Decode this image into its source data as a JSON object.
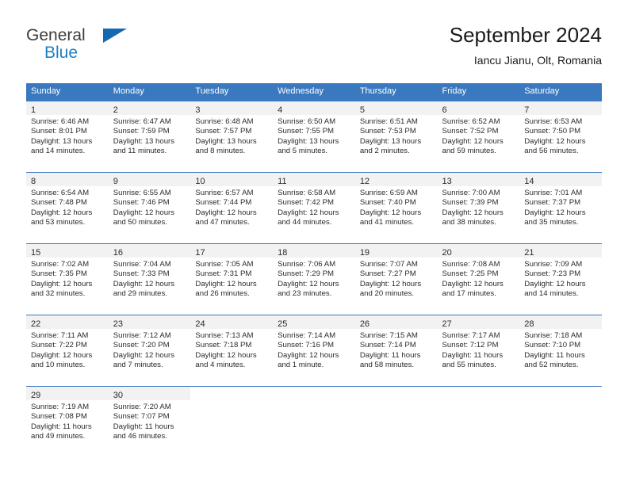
{
  "logo": {
    "primary_text": "General",
    "secondary_text": "Blue",
    "triangle_color": "#1569b0",
    "blue_color": "#1f7fc4"
  },
  "header": {
    "title": "September 2024",
    "subtitle": "Iancu Jianu, Olt, Romania"
  },
  "theme": {
    "header_background": "#3a79bf",
    "header_text": "#ffffff",
    "daynumber_band": "#f2f2f2",
    "grid_line": "#3a79bf",
    "body_text": "#2b2b2b"
  },
  "calendar": {
    "weekday_headers": [
      "Sunday",
      "Monday",
      "Tuesday",
      "Wednesday",
      "Thursday",
      "Friday",
      "Saturday"
    ],
    "weeks": [
      [
        {
          "day": "1",
          "sunrise": "Sunrise: 6:46 AM",
          "sunset": "Sunset: 8:01 PM",
          "daylight": "Daylight: 13 hours and 14 minutes."
        },
        {
          "day": "2",
          "sunrise": "Sunrise: 6:47 AM",
          "sunset": "Sunset: 7:59 PM",
          "daylight": "Daylight: 13 hours and 11 minutes."
        },
        {
          "day": "3",
          "sunrise": "Sunrise: 6:48 AM",
          "sunset": "Sunset: 7:57 PM",
          "daylight": "Daylight: 13 hours and 8 minutes."
        },
        {
          "day": "4",
          "sunrise": "Sunrise: 6:50 AM",
          "sunset": "Sunset: 7:55 PM",
          "daylight": "Daylight: 13 hours and 5 minutes."
        },
        {
          "day": "5",
          "sunrise": "Sunrise: 6:51 AM",
          "sunset": "Sunset: 7:53 PM",
          "daylight": "Daylight: 13 hours and 2 minutes."
        },
        {
          "day": "6",
          "sunrise": "Sunrise: 6:52 AM",
          "sunset": "Sunset: 7:52 PM",
          "daylight": "Daylight: 12 hours and 59 minutes."
        },
        {
          "day": "7",
          "sunrise": "Sunrise: 6:53 AM",
          "sunset": "Sunset: 7:50 PM",
          "daylight": "Daylight: 12 hours and 56 minutes."
        }
      ],
      [
        {
          "day": "8",
          "sunrise": "Sunrise: 6:54 AM",
          "sunset": "Sunset: 7:48 PM",
          "daylight": "Daylight: 12 hours and 53 minutes."
        },
        {
          "day": "9",
          "sunrise": "Sunrise: 6:55 AM",
          "sunset": "Sunset: 7:46 PM",
          "daylight": "Daylight: 12 hours and 50 minutes."
        },
        {
          "day": "10",
          "sunrise": "Sunrise: 6:57 AM",
          "sunset": "Sunset: 7:44 PM",
          "daylight": "Daylight: 12 hours and 47 minutes."
        },
        {
          "day": "11",
          "sunrise": "Sunrise: 6:58 AM",
          "sunset": "Sunset: 7:42 PM",
          "daylight": "Daylight: 12 hours and 44 minutes."
        },
        {
          "day": "12",
          "sunrise": "Sunrise: 6:59 AM",
          "sunset": "Sunset: 7:40 PM",
          "daylight": "Daylight: 12 hours and 41 minutes."
        },
        {
          "day": "13",
          "sunrise": "Sunrise: 7:00 AM",
          "sunset": "Sunset: 7:39 PM",
          "daylight": "Daylight: 12 hours and 38 minutes."
        },
        {
          "day": "14",
          "sunrise": "Sunrise: 7:01 AM",
          "sunset": "Sunset: 7:37 PM",
          "daylight": "Daylight: 12 hours and 35 minutes."
        }
      ],
      [
        {
          "day": "15",
          "sunrise": "Sunrise: 7:02 AM",
          "sunset": "Sunset: 7:35 PM",
          "daylight": "Daylight: 12 hours and 32 minutes."
        },
        {
          "day": "16",
          "sunrise": "Sunrise: 7:04 AM",
          "sunset": "Sunset: 7:33 PM",
          "daylight": "Daylight: 12 hours and 29 minutes."
        },
        {
          "day": "17",
          "sunrise": "Sunrise: 7:05 AM",
          "sunset": "Sunset: 7:31 PM",
          "daylight": "Daylight: 12 hours and 26 minutes."
        },
        {
          "day": "18",
          "sunrise": "Sunrise: 7:06 AM",
          "sunset": "Sunset: 7:29 PM",
          "daylight": "Daylight: 12 hours and 23 minutes."
        },
        {
          "day": "19",
          "sunrise": "Sunrise: 7:07 AM",
          "sunset": "Sunset: 7:27 PM",
          "daylight": "Daylight: 12 hours and 20 minutes."
        },
        {
          "day": "20",
          "sunrise": "Sunrise: 7:08 AM",
          "sunset": "Sunset: 7:25 PM",
          "daylight": "Daylight: 12 hours and 17 minutes."
        },
        {
          "day": "21",
          "sunrise": "Sunrise: 7:09 AM",
          "sunset": "Sunset: 7:23 PM",
          "daylight": "Daylight: 12 hours and 14 minutes."
        }
      ],
      [
        {
          "day": "22",
          "sunrise": "Sunrise: 7:11 AM",
          "sunset": "Sunset: 7:22 PM",
          "daylight": "Daylight: 12 hours and 10 minutes."
        },
        {
          "day": "23",
          "sunrise": "Sunrise: 7:12 AM",
          "sunset": "Sunset: 7:20 PM",
          "daylight": "Daylight: 12 hours and 7 minutes."
        },
        {
          "day": "24",
          "sunrise": "Sunrise: 7:13 AM",
          "sunset": "Sunset: 7:18 PM",
          "daylight": "Daylight: 12 hours and 4 minutes."
        },
        {
          "day": "25",
          "sunrise": "Sunrise: 7:14 AM",
          "sunset": "Sunset: 7:16 PM",
          "daylight": "Daylight: 12 hours and 1 minute."
        },
        {
          "day": "26",
          "sunrise": "Sunrise: 7:15 AM",
          "sunset": "Sunset: 7:14 PM",
          "daylight": "Daylight: 11 hours and 58 minutes."
        },
        {
          "day": "27",
          "sunrise": "Sunrise: 7:17 AM",
          "sunset": "Sunset: 7:12 PM",
          "daylight": "Daylight: 11 hours and 55 minutes."
        },
        {
          "day": "28",
          "sunrise": "Sunrise: 7:18 AM",
          "sunset": "Sunset: 7:10 PM",
          "daylight": "Daylight: 11 hours and 52 minutes."
        }
      ],
      [
        {
          "day": "29",
          "sunrise": "Sunrise: 7:19 AM",
          "sunset": "Sunset: 7:08 PM",
          "daylight": "Daylight: 11 hours and 49 minutes."
        },
        {
          "day": "30",
          "sunrise": "Sunrise: 7:20 AM",
          "sunset": "Sunset: 7:07 PM",
          "daylight": "Daylight: 11 hours and 46 minutes."
        },
        {
          "day": "",
          "sunrise": "",
          "sunset": "",
          "daylight": ""
        },
        {
          "day": "",
          "sunrise": "",
          "sunset": "",
          "daylight": ""
        },
        {
          "day": "",
          "sunrise": "",
          "sunset": "",
          "daylight": ""
        },
        {
          "day": "",
          "sunrise": "",
          "sunset": "",
          "daylight": ""
        },
        {
          "day": "",
          "sunrise": "",
          "sunset": "",
          "daylight": ""
        }
      ]
    ]
  }
}
